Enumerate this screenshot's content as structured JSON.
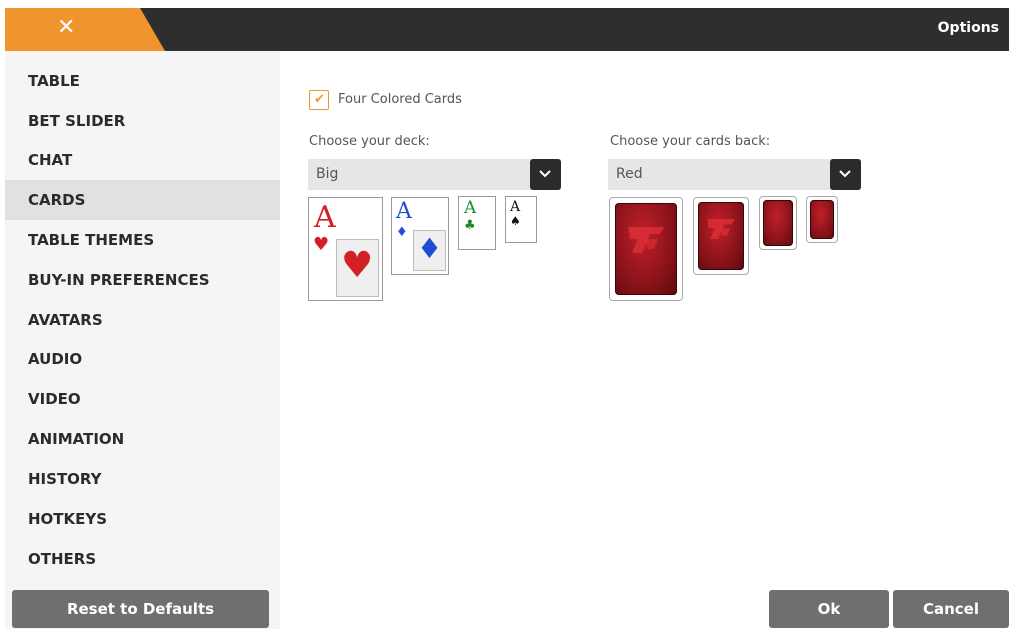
{
  "window": {
    "title": "Options",
    "close_glyph": "✕"
  },
  "sidebar": {
    "items": [
      {
        "label": "TABLE"
      },
      {
        "label": "BET SLIDER"
      },
      {
        "label": "CHAT"
      },
      {
        "label": "CARDS",
        "active": true
      },
      {
        "label": "TABLE THEMES"
      },
      {
        "label": "BUY-IN PREFERENCES"
      },
      {
        "label": "AVATARS"
      },
      {
        "label": "AUDIO"
      },
      {
        "label": "VIDEO"
      },
      {
        "label": "ANIMATION"
      },
      {
        "label": "HISTORY"
      },
      {
        "label": "HOTKEYS"
      },
      {
        "label": "OTHERS"
      }
    ],
    "reset_label": "Reset to Defaults"
  },
  "cards": {
    "four_colored": {
      "label": "Four Colored Cards",
      "checked": true
    },
    "deck": {
      "label": "Choose your deck:",
      "selected": "Big",
      "previews": [
        {
          "rank": "A",
          "suit": "♥",
          "color": "#d32027"
        },
        {
          "rank": "A",
          "suit": "♦",
          "color": "#1f4fd1"
        },
        {
          "rank": "A",
          "suit": "♣",
          "color": "#1d8a2a"
        },
        {
          "rank": "A",
          "suit": "♠",
          "color": "#111111"
        }
      ]
    },
    "back": {
      "label": "Choose your cards back:",
      "selected": "Red"
    }
  },
  "footer": {
    "ok_label": "Ok",
    "cancel_label": "Cancel"
  },
  "colors": {
    "accent": "#f0952d",
    "titlebar": "#2e2e2e",
    "button": "#6f6f6f"
  }
}
